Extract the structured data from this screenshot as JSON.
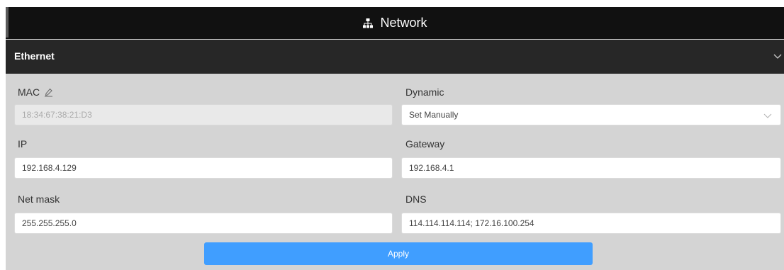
{
  "title": {
    "icon": "sitemap-icon",
    "text": "Network"
  },
  "section": {
    "label": "Ethernet",
    "toggle_icon": "chevron-down-icon"
  },
  "fields": {
    "mac": {
      "label": "MAC",
      "icon": "edit-icon",
      "value": "18:34:67:38:21:D3"
    },
    "dynamic": {
      "label": "Dynamic",
      "value": "Set Manually",
      "icon": "chevron-down-icon"
    },
    "ip": {
      "label": "IP",
      "value": "192.168.4.129"
    },
    "gateway": {
      "label": "Gateway",
      "value": "192.168.4.1"
    },
    "netmask": {
      "label": "Net mask",
      "value": "255.255.255.0"
    },
    "dns": {
      "label": "DNS",
      "value": "114.114.114.114; 172.16.100.254"
    }
  },
  "apply_label": "Apply",
  "colors": {
    "title_bar": "#111111",
    "section_header": "#272727",
    "panel": "#d4d4d4",
    "primary_button": "#409eff"
  }
}
